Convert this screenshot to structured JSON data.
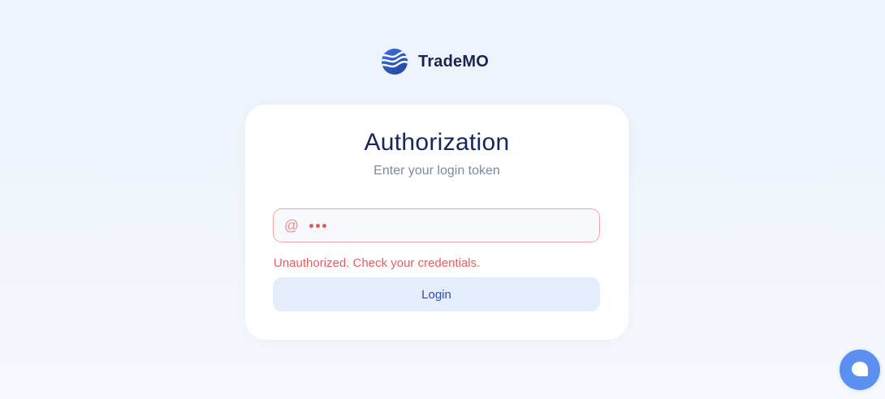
{
  "brand": {
    "name": "TradeMO",
    "logo_icon": "wave-globe-logo-icon",
    "logo_color": "#2f5bd0"
  },
  "auth": {
    "title": "Authorization",
    "subtitle": "Enter your login token",
    "token_field": {
      "icon": "at-sign-icon",
      "value_masked": "•••",
      "state": "error"
    },
    "error_message": "Unauthorized. Check your credentials.",
    "login_label": "Login"
  },
  "chat": {
    "icon": "chat-bubble-icon"
  },
  "colors": {
    "accent": "#2a4fb3",
    "error": "#e65c5c",
    "chat_button": "#5b8ff0"
  }
}
